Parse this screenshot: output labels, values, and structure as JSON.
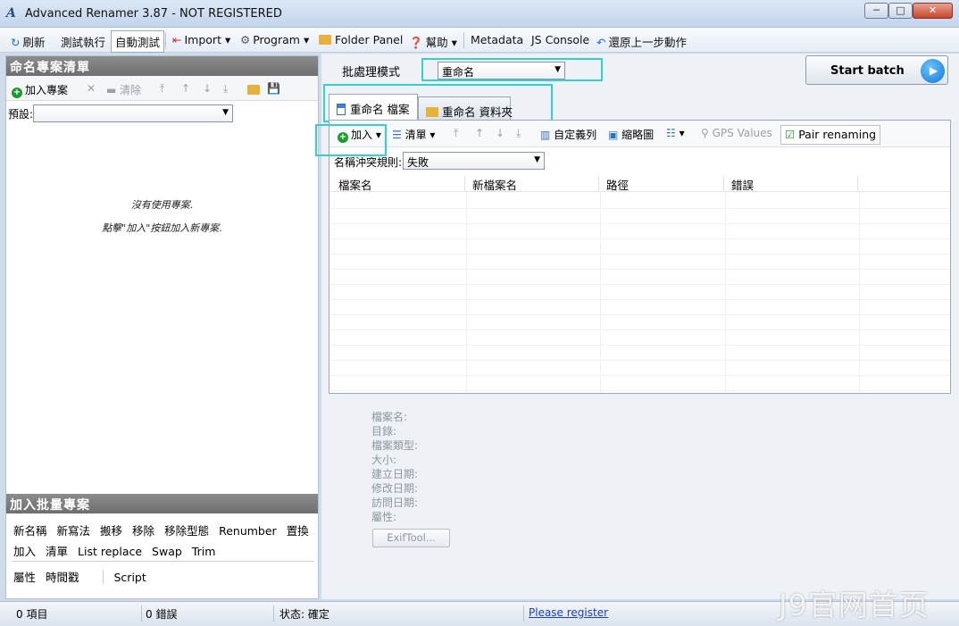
{
  "window": {
    "title": "Advanced Renamer 3.87 - NOT REGISTERED",
    "min": "─",
    "max": "□",
    "close": "✕"
  },
  "menu": {
    "refresh": "刷新",
    "test_run": "測試執行",
    "auto_test": "自動測試",
    "import": "Import",
    "program": "Program",
    "folder_panel": "Folder Panel",
    "help": "幫助",
    "metadata": "Metadata",
    "js_console": "JS Console",
    "undo": "還原上一步動作"
  },
  "left": {
    "header": "命名專案清單",
    "add_project": "加入專案",
    "clear": "清除",
    "preset_label": "預設:",
    "preset_value": "",
    "empty1": "沒有使用專案.",
    "empty2": "點擊\"加入\"按鈕加入新專案.",
    "batch_header": "加入批量專案",
    "methods_row1": [
      "新名稱",
      "新寫法",
      "搬移",
      "移除",
      "移除型態",
      "Renumber",
      "置換"
    ],
    "methods_row2": [
      "加入",
      "清單",
      "List replace",
      "Swap",
      "Trim"
    ],
    "methods_row3": [
      "屬性",
      "時間戳"
    ],
    "script": "Script"
  },
  "right": {
    "mode_label": "批處理模式",
    "mode_value": "重命名",
    "start_batch": "Start batch",
    "tab_files": "重命名 檔案",
    "tab_folders": "重命名 資料夾",
    "add": "加入",
    "list": "清單",
    "custom_cols": "自定義列",
    "thumbnails": "縮略圖",
    "gps": "GPS Values",
    "pair": "Pair renaming",
    "conflict_label": "名稱沖突規則:",
    "conflict_value": "失敗",
    "columns": [
      "檔案名",
      "新檔案名",
      "路徑",
      "錯誤"
    ]
  },
  "info": {
    "labels": [
      "檔案名:",
      "目錄:",
      "檔案類型:",
      "大小:",
      "建立日期:",
      "修改日期:",
      "訪問日期:",
      "屬性:"
    ],
    "exif": "ExifTool..."
  },
  "status": {
    "items": "0 項目",
    "errors": "0 錯誤",
    "state": "状态: 確定",
    "register": "Please register"
  },
  "watermark": "J9官网首页"
}
